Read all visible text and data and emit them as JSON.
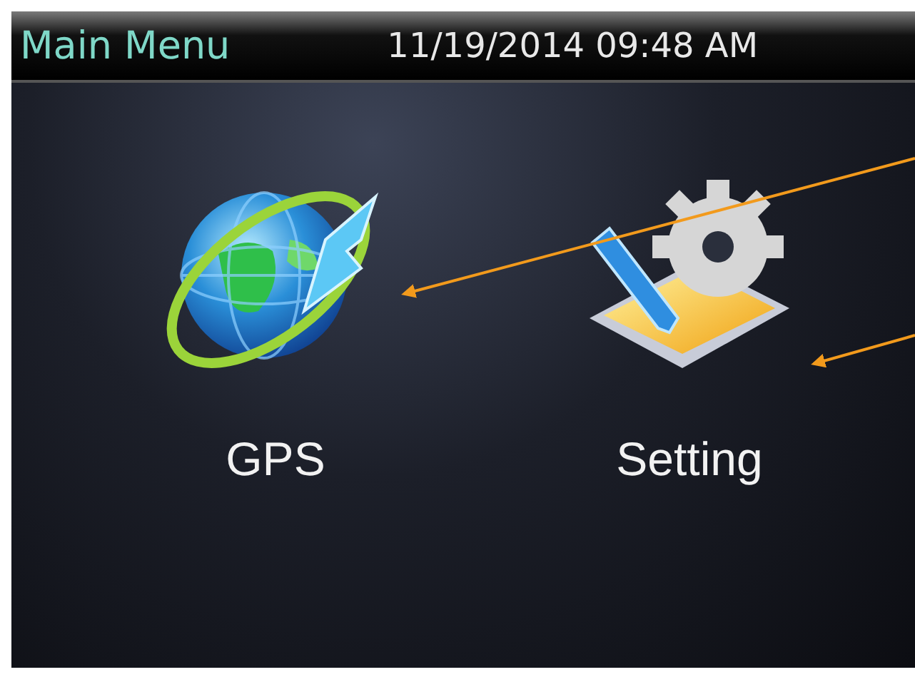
{
  "header": {
    "title": "Main Menu",
    "datetime": "11/19/2014 09:48 AM"
  },
  "menu_items": [
    {
      "label": "GPS",
      "kind": "gps"
    },
    {
      "label": "Setting",
      "kind": "setting"
    }
  ]
}
